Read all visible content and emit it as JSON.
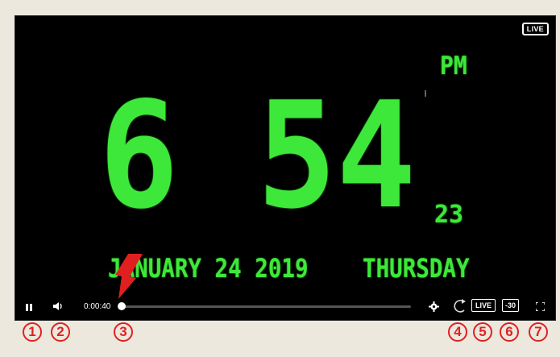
{
  "player": {
    "live_badge": "LIVE",
    "clock": {
      "ampm": "PM",
      "hour": "6",
      "minutes": "54",
      "seconds": "23",
      "date": "JANUARY 24 2019",
      "weekday": "THURSDAY",
      "color": "#3ee83a"
    },
    "controls": {
      "pause_icon": "pause-icon",
      "volume_icon": "volume-icon",
      "time": "0:00:40",
      "seek_progress": 0.0,
      "gear_icon": "gear-icon",
      "replay_icon": "replay-icon",
      "live_label": "LIVE",
      "back30_label": "-30",
      "fullscreen_icon": "fullscreen-icon"
    }
  },
  "annotations": {
    "arrow_color": "#e02020",
    "markers": [
      "1",
      "2",
      "3",
      "4",
      "5",
      "6",
      "7"
    ]
  }
}
